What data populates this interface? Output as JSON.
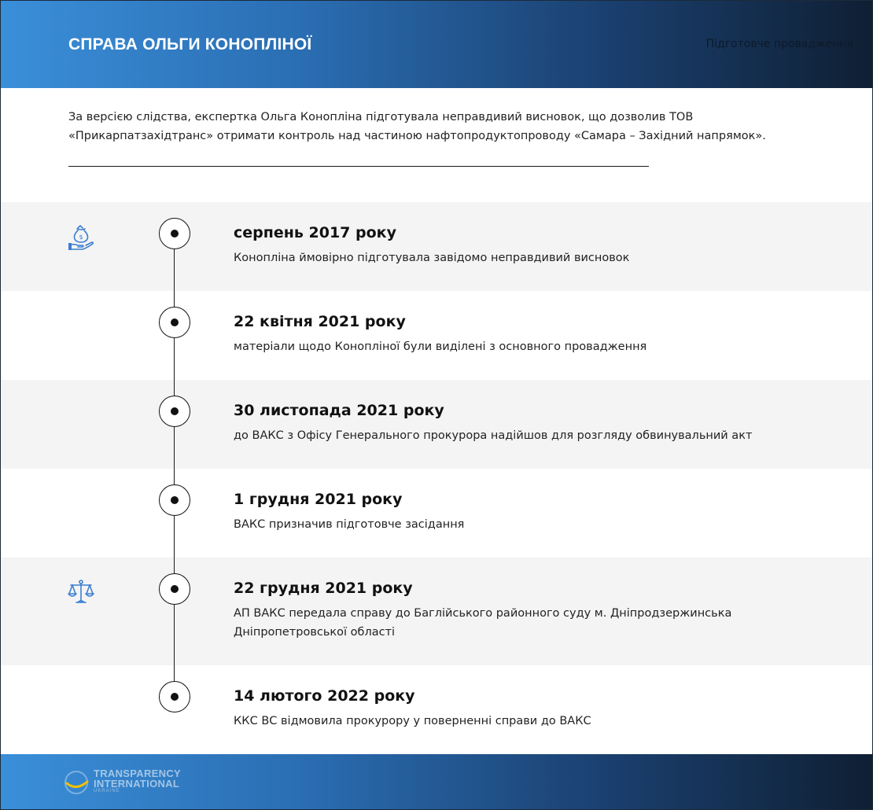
{
  "header": {
    "title": "СПРАВА ОЛЬГИ КОНОПЛІНОЇ",
    "stage": "Підготовче провадження"
  },
  "intro": "За версією слідства, експертка Ольга Конопліна підготувала неправдивий висновок, що дозволив ТОВ «Прикарпатзахідтранс» отримати контроль над частиною нафтопродуктопроводу «Самара – Західний напрямок».",
  "events": [
    {
      "date": "серпень 2017 року",
      "text": "Конопліна ймовірно підготувала завідомо неправдивий висновок",
      "icon": "money-bag-hand-icon"
    },
    {
      "date": "22 квітня 2021 року",
      "text": "матеріали щодо Коноплінoї були виділені з основного провадження",
      "icon": ""
    },
    {
      "date": "30 листопада 2021 року",
      "text": "до ВАКС з Офісу Генерального прокурора надійшов для розгляду обвинувальний акт",
      "icon": ""
    },
    {
      "date": "1 грудня 2021 року",
      "text": "ВАКС призначив підготовче засідання",
      "icon": ""
    },
    {
      "date": "22 грудня 2021 року",
      "text": "АП ВАКС передала справу до Баглійського районного суду м. Дніпродзержинська Дніпропетровської області",
      "icon": "scales-icon"
    },
    {
      "date": "14 лютого 2022 року",
      "text": "ККС ВС відмовила прокурору у поверненні справи до ВАКС",
      "icon": ""
    }
  ],
  "footer": {
    "logo_line1": "TRANSPARENCY",
    "logo_line2": "INTERNATIONAL",
    "logo_line3": "UKRAINE"
  },
  "colors": {
    "accent_blue": "#3a8fd9",
    "dark_navy": "#0f1f33",
    "row_shade": "#f4f4f4",
    "icon_blue": "#3a7fd0"
  }
}
